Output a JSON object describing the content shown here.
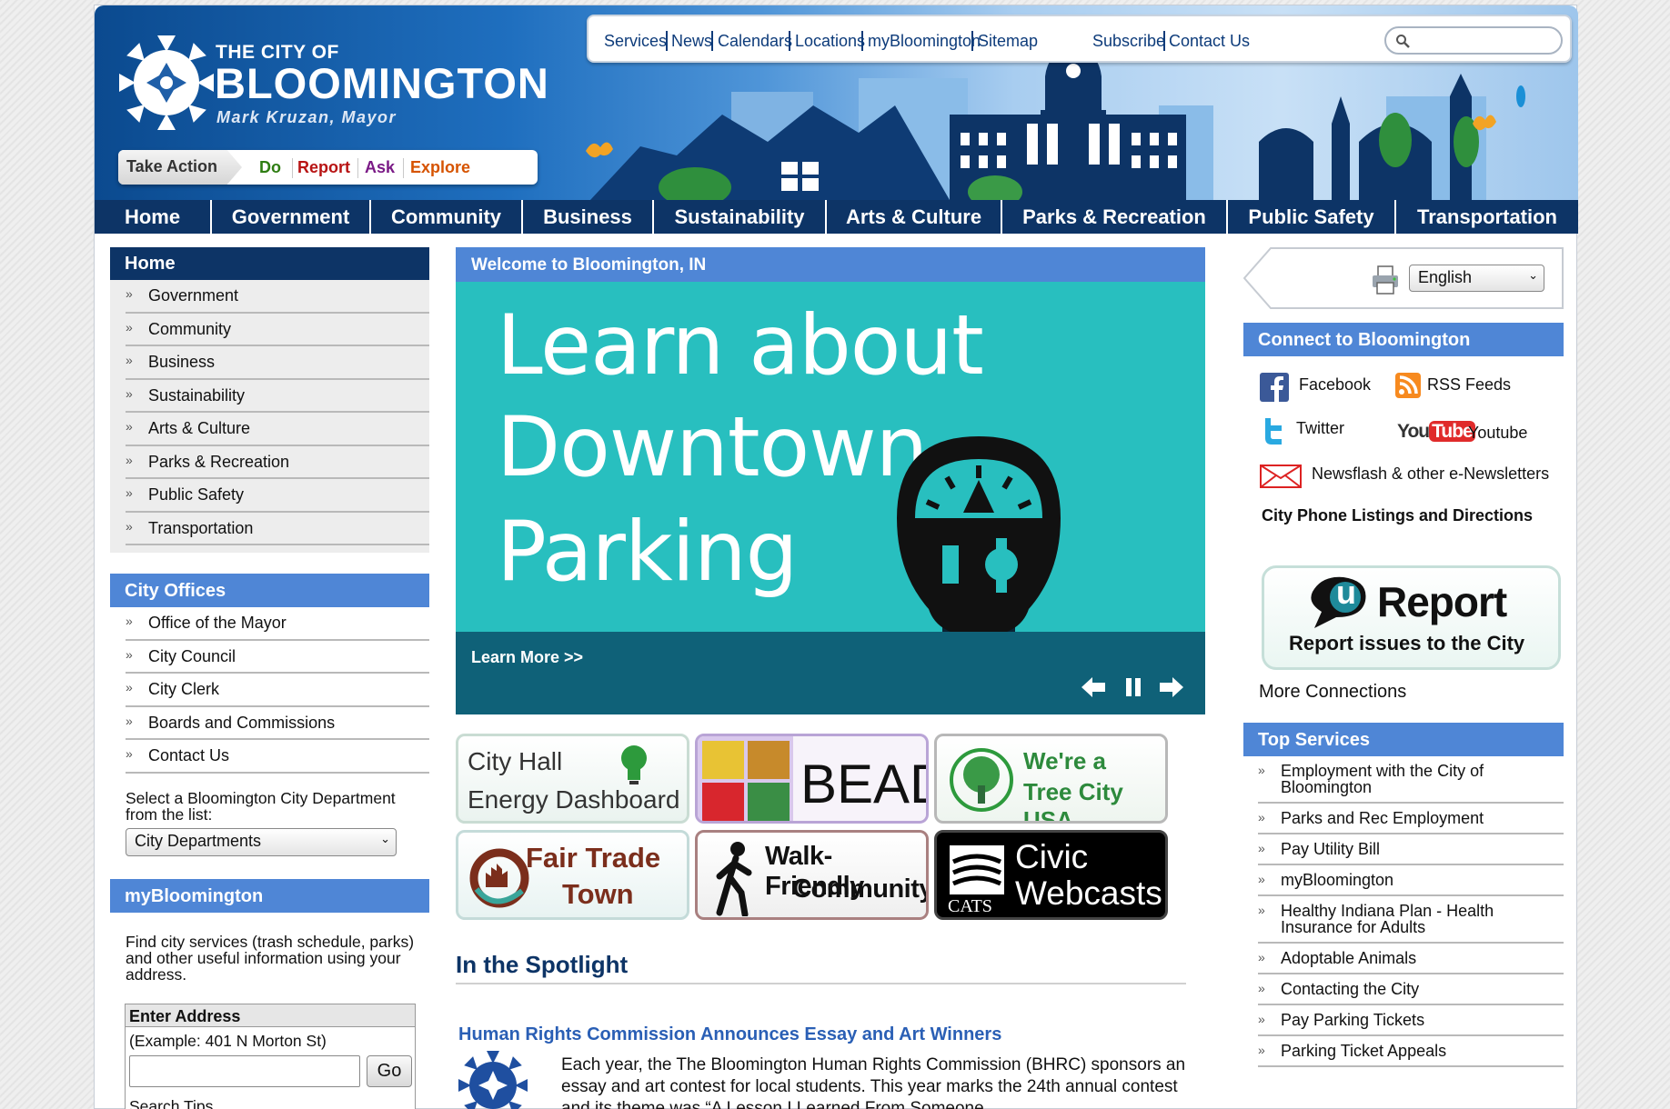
{
  "utility_nav": {
    "links": [
      "Services",
      "News",
      "Calendars",
      "Locations",
      "myBloomington",
      "Sitemap"
    ],
    "subscribe": "Subscribe",
    "contact": "Contact Us",
    "search_placeholder": ""
  },
  "logo": {
    "small": "THE CITY OF",
    "big": "BLOOMINGTON",
    "mayor": "Mark Kruzan, Mayor"
  },
  "take_action": {
    "label": "Take Action",
    "links": [
      {
        "label": "Do",
        "color": "#2e7d12"
      },
      {
        "label": "Report",
        "color": "#b81414"
      },
      {
        "label": "Ask",
        "color": "#7a1a86"
      },
      {
        "label": "Explore",
        "color": "#d65300"
      }
    ]
  },
  "main_nav": [
    "Home",
    "Government",
    "Community",
    "Business",
    "Sustainability",
    "Arts & Culture",
    "Parks & Recreation",
    "Public Safety",
    "Transportation"
  ],
  "sidebar": {
    "home_title": "Home",
    "home_items": [
      "Government",
      "Community",
      "Business",
      "Sustainability",
      "Arts & Culture",
      "Parks & Recreation",
      "Public Safety",
      "Transportation"
    ],
    "offices_title": "City Offices",
    "offices_items": [
      "Office of the Mayor",
      "City Council",
      "City Clerk",
      "Boards and Commissions",
      "Contact Us"
    ],
    "dept_label": "Select a Bloomington City Department from the list:",
    "dept_selected": "City Departments",
    "mybloomington_title": "myBloomington",
    "mybloomington_text": "Find city services (trash schedule, parks) and other useful information using your address.",
    "address_head": "Enter Address",
    "address_example": "(Example: 401 N Morton St)",
    "address_value": "",
    "go_label": "Go",
    "search_tips": "Search Tips"
  },
  "center": {
    "welcome": "Welcome to Bloomington, IN",
    "slide_lines": [
      "Learn about",
      "Downtown",
      "Parking"
    ],
    "learn_more": "Learn More >>",
    "tiles": {
      "energy_line1": "City Hall",
      "energy_line2": "Energy Dashboard",
      "bead": "BEAD",
      "tree_line1": "We're a",
      "tree_line2": "Tree City USA",
      "fair_line1": "Fair Trade",
      "fair_line2": "Town",
      "walk_line1": "Walk-Friendly",
      "walk_line2": "Community",
      "civic_line1": "Civic",
      "civic_line2": "Webcasts",
      "cats": "CATS"
    },
    "spotlight_title": "In the Spotlight",
    "news_title": "Human Rights Commission Announces Essay and Art Winners",
    "news_body": "Each year, the The Bloomington Human Rights Commission (BHRC) sponsors an essay and art contest for local students. This year marks the 24th annual contest and its theme was “A Lesson I Learned From Someone"
  },
  "right": {
    "language": "English",
    "connect_title": "Connect to Bloomington",
    "facebook": "Facebook",
    "rss": "RSS Feeds",
    "twitter": "Twitter",
    "youtube": "Youtube",
    "youtube_logo_you": "You",
    "youtube_logo_tube": "Tube",
    "newsletter": "Newsflash & other e-Newsletters",
    "phone": "City Phone Listings and Directions",
    "ureport_u": "u",
    "ureport_word": "Report",
    "ureport_sub": "Report issues to the City",
    "more": "More Connections",
    "top_title": "Top Services",
    "top_items": [
      "Employment with the City of Bloomington",
      "Parks and Rec Employment",
      "Pay Utility Bill",
      "myBloomington",
      "Healthy Indiana Plan - Health Insurance for Adults",
      "Adoptable Animals",
      "Contacting the City",
      "Pay Parking Tickets",
      "Parking Ticket Appeals"
    ]
  },
  "colors": {
    "navy": "#0d3466",
    "accent_blue": "#4f86d6",
    "slide_teal": "#28bfbf",
    "link_blue": "#2a5fb5"
  }
}
